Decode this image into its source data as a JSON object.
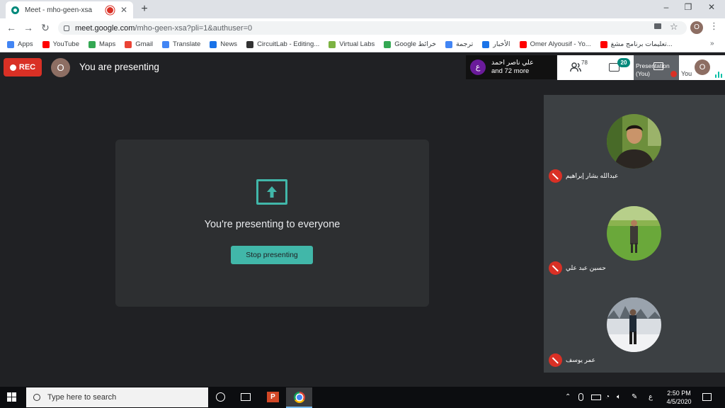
{
  "browser": {
    "tab_title": "Meet - mho-geen-xsa",
    "new_tab_symbol": "+",
    "url_host": "meet.google.com",
    "url_path": "/mho-geen-xsa?pli=1&authuser=0",
    "profile_initial": "O",
    "window_controls": [
      "–",
      "❐",
      "✕"
    ]
  },
  "bookmarks": [
    {
      "label": "Apps",
      "icon": "apps-grid-icon",
      "color": "#4285f4"
    },
    {
      "label": "YouTube",
      "icon": "youtube-icon",
      "color": "#ff0000"
    },
    {
      "label": "Maps",
      "icon": "maps-icon",
      "color": "#34a853"
    },
    {
      "label": "Gmail",
      "icon": "gmail-icon",
      "color": "#ea4335"
    },
    {
      "label": "Translate",
      "icon": "translate-icon",
      "color": "#4285f4"
    },
    {
      "label": "News",
      "icon": "news-icon",
      "color": "#1a73e8"
    },
    {
      "label": "CircuitLab - Editing...",
      "icon": "circuitlab-icon",
      "color": "#333333"
    },
    {
      "label": "Virtual Labs",
      "icon": "virtual-labs-icon",
      "color": "#7cb342"
    },
    {
      "label": "Google خرائط",
      "icon": "maps-icon",
      "color": "#34a853"
    },
    {
      "label": "ترجمة",
      "icon": "translate-icon",
      "color": "#4285f4"
    },
    {
      "label": "الأخبار",
      "icon": "news-icon",
      "color": "#1a73e8"
    },
    {
      "label": "Omer Alyousif - Yo...",
      "icon": "youtube-icon",
      "color": "#ff0000"
    },
    {
      "label": "تعليمات برنامج مشغ...",
      "icon": "youtube-icon",
      "color": "#ff0000"
    }
  ],
  "bookmarks_more": "»",
  "meet": {
    "rec_label": "REC",
    "presenter_initial": "O",
    "presenting_label": "You are presenting",
    "chip_initial": "ع",
    "chip_name": "علي ناصر احمد",
    "chip_more": "and 72 more",
    "people_count": "78",
    "chat_count": "20",
    "self_tile_label": "Presentation (You)",
    "you_label": "You",
    "you_initial": "O",
    "present_message": "You're presenting to everyone",
    "stop_button": "Stop presenting",
    "accent_color": "#41b7a9",
    "rec_color": "#d93025"
  },
  "participants": [
    {
      "name": "عبدالله بشار إبراهيم",
      "muted": true
    },
    {
      "name": "حسين عبد علي",
      "muted": true
    },
    {
      "name": "عمر يوسف",
      "muted": true
    }
  ],
  "taskbar": {
    "search_placeholder": "Type here to search",
    "ppt_letter": "P",
    "tray_lang": "ع",
    "clock_time": "2:50 PM",
    "clock_date": "4/5/2020"
  }
}
